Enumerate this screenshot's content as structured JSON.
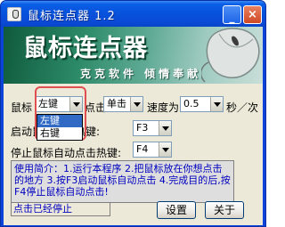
{
  "window": {
    "title": "鼠标连点器 1.2",
    "min_label": "_",
    "close_label": "×"
  },
  "banner": {
    "title": "鼠标连点器",
    "subtitle": "克克软件 倾情奉献"
  },
  "settings": {
    "mouse_label": "鼠标",
    "button_value": "左键",
    "click_label": "点击",
    "click_type_value": "单击",
    "speed_label": "速度为",
    "speed_value": "0.5",
    "speed_unit": "秒／次",
    "start_label": "启动鼠标点击热键:",
    "start_hotkey": "F3",
    "stop_label": "停止鼠标自动点击热键:",
    "stop_hotkey": "F4"
  },
  "dropdown": {
    "options": [
      "左键",
      "右键"
    ],
    "selected": "左键"
  },
  "help_text": "使用简介：1.运行本程序 2.把鼠标放在你想点击的地方 3.按F3启动鼠标自动点击 4.完成目的后,按F4停止鼠标自动点击!",
  "status_text": "点击已经停止",
  "buttons": {
    "settings": "设置",
    "about": "关于"
  },
  "colors": {
    "title_bar": "#0a4ad6",
    "banner_start": "#0f5a3c",
    "help_text": "#0000c0",
    "highlight": "#e05050",
    "selection": "#316ac5"
  }
}
